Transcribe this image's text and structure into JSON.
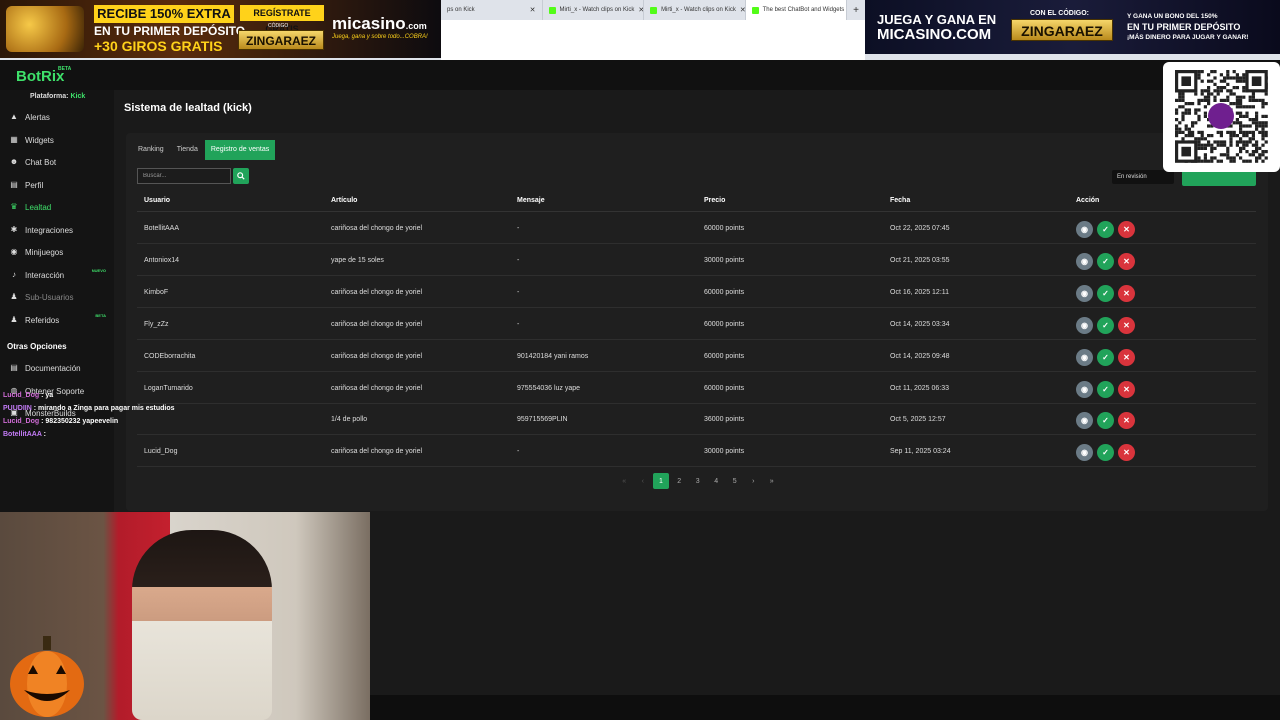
{
  "browser": {
    "tabs": [
      {
        "label": "ps on Kick",
        "active": false
      },
      {
        "label": "Mirti_x - Watch clips on Kick",
        "active": false
      },
      {
        "label": "Mirti_x - Watch clips on Kick",
        "active": false
      },
      {
        "label": "The best ChatBot and Widgets",
        "active": true
      }
    ],
    "new_tab_icon": "plus-icon"
  },
  "ad_left": {
    "headline": "RECIBE 150% EXTRA",
    "line2": "EN TU PRIMER DEPÓSITO",
    "line3": "+30 GIROS GRATIS",
    "register": "REGÍSTRATE GRATIS",
    "code_label": "CÓDIGO",
    "code": "ZINGARAEZ",
    "brand": "micasino",
    "brand_suffix": ".com",
    "tagline": "Juega, gana y sobre todo...COBRA!"
  },
  "ad_right": {
    "line1": "JUEGA Y GANA EN",
    "line2": "MICASINO.COM",
    "code_label": "CON EL CÓDIGO:",
    "code": "ZINGARAEZ",
    "side_line1": "Y GANA UN BONO DEL 150%",
    "side_line2": "EN TU PRIMER DEPÓSITO",
    "side_line3": "¡MÁS DINERO PARA JUGAR Y GANAR!"
  },
  "app": {
    "logo": "BotRix",
    "logo_badge": "BETA",
    "platform_label": "Plataforma:",
    "platform_value": "Kick"
  },
  "sidebar": {
    "items": [
      {
        "label": "Alertas",
        "icon": "alert-icon",
        "glyph": "▲"
      },
      {
        "label": "Widgets",
        "icon": "grid-icon",
        "glyph": "▦"
      },
      {
        "label": "Chat Bot",
        "icon": "robot-icon",
        "glyph": "☻"
      },
      {
        "label": "Perfil",
        "icon": "profile-icon",
        "glyph": "▤"
      },
      {
        "label": "Lealtad",
        "icon": "trophy-icon",
        "glyph": "♛"
      },
      {
        "label": "Integraciones",
        "icon": "gear-icon",
        "glyph": "✱"
      },
      {
        "label": "Minijuegos",
        "icon": "gamepad-icon",
        "glyph": "◉"
      },
      {
        "label": "Interacción",
        "icon": "music-icon",
        "glyph": "♪",
        "badge": "NUEVO"
      },
      {
        "label": "Sub-Usuarios",
        "icon": "users-icon",
        "glyph": "♟"
      },
      {
        "label": "Referidos",
        "icon": "user-plus-icon",
        "glyph": "♟",
        "badge": "BETA"
      }
    ],
    "other_heading": "Otras Opciones",
    "other_items": [
      {
        "label": "Documentación",
        "icon": "document-icon",
        "glyph": "▤"
      },
      {
        "label": "Obtener Soporte",
        "icon": "support-icon",
        "glyph": "◍"
      },
      {
        "label": "MonsterBuilds",
        "icon": "monster-icon",
        "glyph": "▣"
      }
    ]
  },
  "main": {
    "title": "Sistema de lealtad (kick)",
    "tabs": [
      {
        "label": "Ranking",
        "active": false
      },
      {
        "label": "Tienda",
        "active": false
      },
      {
        "label": "Registro de ventas",
        "active": true
      }
    ],
    "search_placeholder": "Buscar...",
    "filter_value": "En revisión"
  },
  "table": {
    "columns": [
      "Usuario",
      "Artículo",
      "Mensaje",
      "Precio",
      "Fecha",
      "Acción"
    ],
    "rows": [
      {
        "user": "BotellitAAA",
        "item": "cariñosa del chongo de yoriel",
        "message": "-",
        "price": "60000 points",
        "date": "Oct 22, 2025 07:45"
      },
      {
        "user": "Antoniox14",
        "item": "yape de 15 soles",
        "message": "-",
        "price": "30000 points",
        "date": "Oct 21, 2025 03:55"
      },
      {
        "user": "KimboF",
        "item": "cariñosa del chongo de yoriel",
        "message": "-",
        "price": "60000 points",
        "date": "Oct 16, 2025 12:11"
      },
      {
        "user": "Fly_zZz",
        "item": "cariñosa del chongo de yoriel",
        "message": "-",
        "price": "60000 points",
        "date": "Oct 14, 2025 03:34"
      },
      {
        "user": "CODEborrachita",
        "item": "cariñosa del chongo de yoriel",
        "message": "901420184 yani ramos",
        "price": "60000 points",
        "date": "Oct 14, 2025 09:48"
      },
      {
        "user": "LoganTumarido",
        "item": "cariñosa del chongo de yoriel",
        "message": "975554036 luz yape",
        "price": "60000 points",
        "date": "Oct 11, 2025 06:33"
      },
      {
        "user": "",
        "item": "1/4 de pollo",
        "message": "959715569PLIN",
        "price": "36000 points",
        "date": "Oct 5, 2025 12:57"
      },
      {
        "user": "Lucid_Dog",
        "item": "cariñosa del chongo de yoriel",
        "message": "-",
        "price": "30000 points",
        "date": "Sep 11, 2025 03:24"
      }
    ]
  },
  "pagination": {
    "first": "«",
    "prev": "‹",
    "pages": [
      "1",
      "2",
      "3",
      "4",
      "5"
    ],
    "current": "1",
    "next": "›",
    "last": "»"
  },
  "chat": [
    {
      "user": "Lucid_Dog",
      "message": "ya",
      "color": "#d06cd6"
    },
    {
      "user": "PUUDIIN",
      "message": "mirando a Zinga para pagar mis estudios",
      "color": "#c47cf7"
    },
    {
      "user": "Lucid_Dog",
      "message": "982350232 yapeevelin",
      "color": "#d06cd6"
    },
    {
      "user": "BotellitAAA",
      "message": "",
      "color": "#c47cf7"
    }
  ],
  "colors": {
    "accent": "#21a35a",
    "accent_text": "#3ee06a",
    "danger": "#d9343c",
    "neutral_btn": "#6b7b86",
    "bg": "#1a1a1a",
    "panel": "#1f1f1f"
  }
}
